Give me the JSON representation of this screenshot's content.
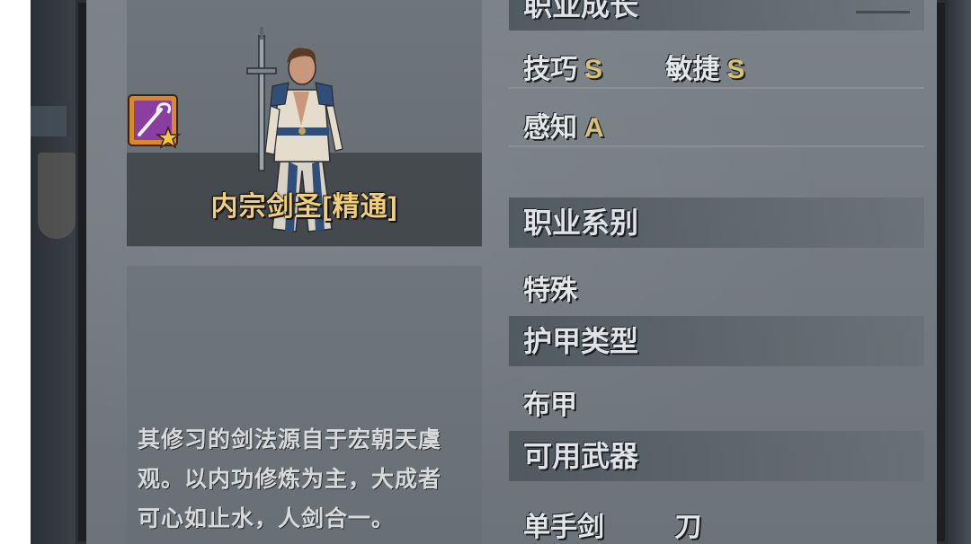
{
  "profession": {
    "name": "内宗剑圣[精通]",
    "description_lines": [
      "其修习的剑法源自于宏朝天虞",
      "观。以内功修炼为主，大成者",
      "可心如止水，人剑合一。"
    ],
    "badge_icon": "staff-icon",
    "badge_star_icon": "star-icon"
  },
  "growth": {
    "header": "职业成长",
    "stats": [
      {
        "label": "技巧",
        "grade": "S"
      },
      {
        "label": "敏捷",
        "grade": "S"
      },
      {
        "label": "感知",
        "grade": "A"
      }
    ]
  },
  "series": {
    "header": "职业系别",
    "value": "特殊"
  },
  "armor": {
    "header": "护甲类型",
    "value": "布甲"
  },
  "weapons": {
    "header": "可用武器",
    "items": [
      "单手剑",
      "刀"
    ]
  },
  "colors": {
    "name_gold": "#f1cf78",
    "grade_gold": "#d8c27a",
    "badge_orange": "#d9892a",
    "badge_purple": "#8a3fa0"
  }
}
